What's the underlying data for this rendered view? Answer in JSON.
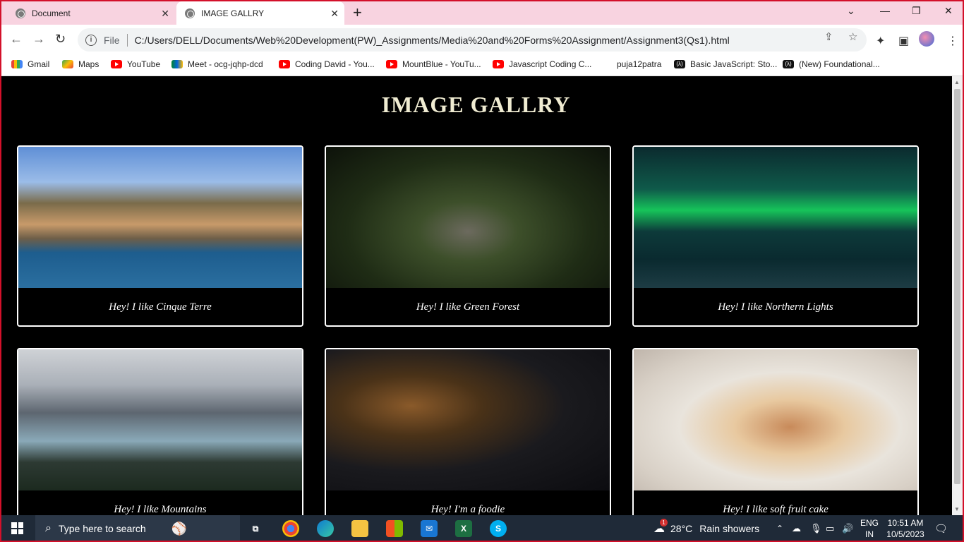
{
  "browser": {
    "tabs": [
      {
        "title": "Document",
        "active": false
      },
      {
        "title": "IMAGE GALLRY",
        "active": true
      }
    ],
    "file_label": "File",
    "url": "C:/Users/DELL/Documents/Web%20Development(PW)_Assignments/Media%20and%20Forms%20Assignment/Assignment3(Qs1).html",
    "bookmarks": [
      {
        "label": "Gmail",
        "icon": "gmail-icon"
      },
      {
        "label": "Maps",
        "icon": "maps-icon"
      },
      {
        "label": "YouTube",
        "icon": "youtube-icon"
      },
      {
        "label": "Meet - ocg-jqhp-dcd",
        "icon": "meet-icon"
      },
      {
        "label": "Coding David - You...",
        "icon": "youtube-icon"
      },
      {
        "label": "MountBlue - YouTu...",
        "icon": "youtube-icon"
      },
      {
        "label": "Javascript Coding C...",
        "icon": "youtube-icon"
      },
      {
        "label": "puja12patra",
        "icon": ""
      },
      {
        "label": "Basic JavaScript: Sto...",
        "icon": "freecodecamp-icon"
      },
      {
        "label": "(New) Foundational...",
        "icon": "freecodecamp-icon"
      }
    ]
  },
  "page": {
    "title": "IMAGE GALLRY",
    "cards": [
      {
        "caption": "Hey! I like Cinque Terre"
      },
      {
        "caption": "Hey! I like Green Forest"
      },
      {
        "caption": "Hey! I like Northern Lights"
      },
      {
        "caption": "Hey! I like Mountains"
      },
      {
        "caption": "Hey! I'm a foodie"
      },
      {
        "caption": "Hey! I like soft fruit cake"
      }
    ]
  },
  "taskbar": {
    "search_placeholder": "Type here to search",
    "weather_temp": "28°C",
    "weather_text": "Rain showers",
    "weather_badge": "1",
    "lang_top": "ENG",
    "lang_bottom": "IN",
    "time": "10:51 AM",
    "date": "10/5/2023"
  }
}
